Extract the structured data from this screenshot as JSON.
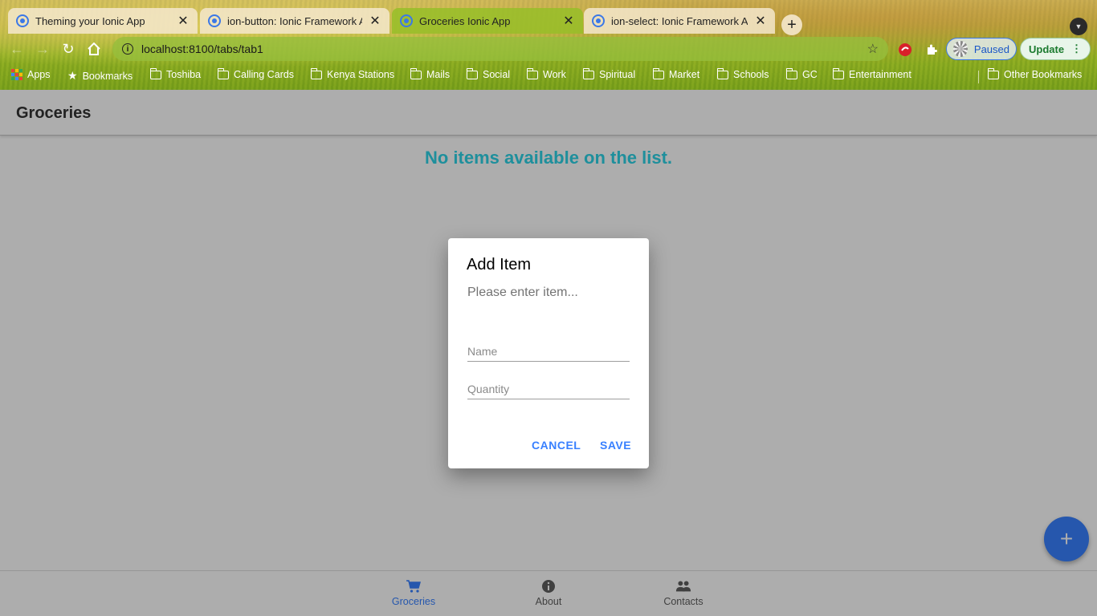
{
  "browser": {
    "tabs": [
      {
        "title": "Theming your Ionic App",
        "close": "✕"
      },
      {
        "title": "ion-button: Ionic Framework API",
        "close": "✕"
      },
      {
        "title": "Groceries Ionic App",
        "close": "✕"
      },
      {
        "title": "ion-select: Ionic Framework API",
        "close": "✕"
      }
    ],
    "active_tab": 2,
    "new_tab": "+",
    "url": "localhost:8100/tabs/tab1",
    "profile_label": "Paused",
    "update_label": "Update",
    "bookmarks": [
      "Apps",
      "Bookmarks",
      "Toshiba",
      "Calling Cards",
      "Kenya Stations",
      "Mails",
      "Social",
      "Work",
      "Spiritual",
      "Market",
      "Schools",
      "GC",
      "Entertainment"
    ],
    "other_bookmarks": "Other Bookmarks"
  },
  "app": {
    "header_title": "Groceries",
    "empty_message": "No items available on the list.",
    "fab_label": "+",
    "accent_color": "#3880ff",
    "empty_color": "#2dd3e6",
    "tabs": [
      {
        "label": "Groceries",
        "icon": "cart-icon",
        "selected": true
      },
      {
        "label": "About",
        "icon": "info-icon",
        "selected": false
      },
      {
        "label": "Contacts",
        "icon": "people-icon",
        "selected": false
      }
    ]
  },
  "alert": {
    "title": "Add Item",
    "message": "Please enter item...",
    "inputs": [
      {
        "placeholder": "Name",
        "value": ""
      },
      {
        "placeholder": "Quantity",
        "value": ""
      }
    ],
    "cancel_label": "CANCEL",
    "save_label": "SAVE"
  }
}
